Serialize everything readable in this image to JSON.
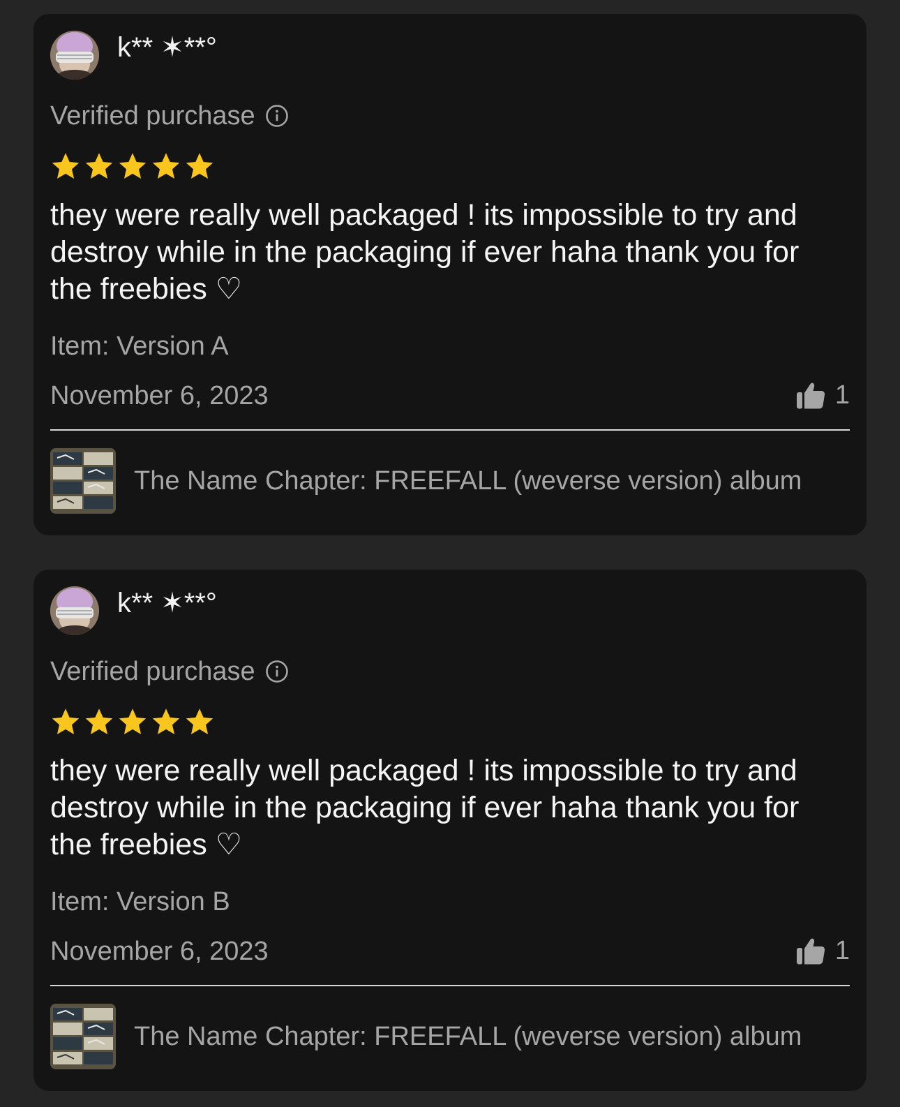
{
  "colors": {
    "page_background": "#252525",
    "card_background": "#141414",
    "primary_text": "#f5f5f5",
    "secondary_text": "#a6a6a6",
    "star_color": "#f8c61c",
    "divider": "#d9d9d9"
  },
  "reviews": [
    {
      "reviewer_name": "k** ✶**°",
      "verified_label": "Verified purchase",
      "verified_icon": "info-circle-icon",
      "rating": 5,
      "rating_max": 5,
      "text": "they were really well packaged ! its impossible to try and destroy while in the packaging if ever haha thank you for the freebies ♡",
      "item": "Item: Version A",
      "date": "November 6, 2023",
      "helpful_icon": "thumbs-up-icon",
      "helpful_count": "1",
      "product_title": "The Name Chapter: FREEFALL (weverse version) album"
    },
    {
      "reviewer_name": "k** ✶**°",
      "verified_label": "Verified purchase",
      "verified_icon": "info-circle-icon",
      "rating": 5,
      "rating_max": 5,
      "text": "they were really well packaged ! its impossible to try and destroy while in the packaging if ever haha thank you for the freebies ♡",
      "item": "Item: Version B",
      "date": "November 6, 2023",
      "helpful_icon": "thumbs-up-icon",
      "helpful_count": "1",
      "product_title": "The Name Chapter: FREEFALL (weverse version) album"
    }
  ]
}
